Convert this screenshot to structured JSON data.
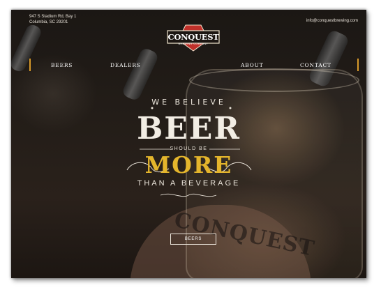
{
  "address": {
    "line1": "947 S Stadium Rd, Bay 1",
    "line2": "Columbia, SC 29201"
  },
  "email": "info@conquestbrewing.com",
  "logo": {
    "word": "CONQUEST",
    "sub": "BREWING COMPANY",
    "colors": {
      "shield": "#c0302a",
      "border": "#f1e6cf"
    }
  },
  "nav": {
    "items": [
      "BEERS",
      "DEALERS",
      "ABOUT",
      "CONTACT"
    ]
  },
  "hero": {
    "we_believe": "WE BELIEVE",
    "beer": "BEER",
    "should_be": "SHOULD BE",
    "more": "MORE",
    "than": "THAN A BEVERAGE",
    "accent_color": "#e4b52c"
  },
  "cta": {
    "label": "BEERS"
  },
  "glass_logo": "CONQUEST"
}
